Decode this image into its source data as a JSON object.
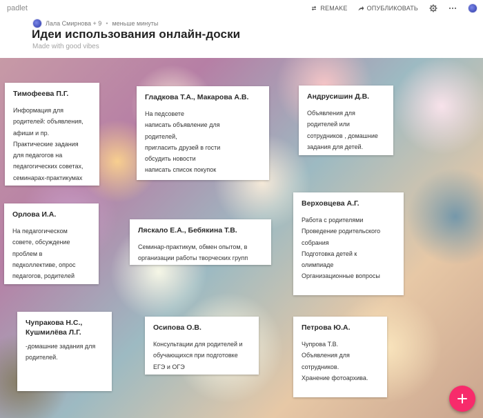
{
  "app": {
    "logo": "padlet"
  },
  "toolbar": {
    "remake_label": "REMAKE",
    "publish_label": "ОПУБЛИКОВАТЬ"
  },
  "header": {
    "authors": "Лала Смирнова + 9",
    "separator": "•",
    "time": "меньше минуты",
    "title": "Идеи использования онлайн-доски",
    "subtitle": "Made with good vibes"
  },
  "cards": [
    {
      "title": "Тимофеева П.Г.",
      "body": "Информация для\nродителей: объявления,\nафиши и пр.\nПрактические задания\nдля педагогов на\nпедагогических советах,\nсеминарах-практикумах"
    },
    {
      "title": "Гладкова Т.А., Макарова А.В.",
      "body": "На педсовете\nнаписать объявление для\nродителей,\nпригласить друзей в гости\nобсудить новости\nнаписать список покупок"
    },
    {
      "title": "Андрусишин Д.В.",
      "body": "Объявления для\nродителей или\nсотрудников , домашние\nзадания для детей."
    },
    {
      "title": "Орлова И.А.",
      "body": "На педагогическом\nсовете, обсуждение\nпроблем в\nпедколлективе, опрос\nпедагогов, родителей"
    },
    {
      "title": "Ляскало Е.А., Бебякина Т.В.",
      "body": "Семинар-практикум, обмен опытом, в\nорганизации работы творческих групп"
    },
    {
      "title": "Верховцева А.Г.",
      "body": "Работа с родителями\nПроведение родительского\nсобрания\nПодготовка детей к\nолимпиаде\nОрганизационные вопросы"
    },
    {
      "title": "Чупракова Н.С.,\nКушмилёва Л.Г.",
      "body": "-домашние задания для\nродителей."
    },
    {
      "title": "Осипова О.В.",
      "body": "Консультации для родителей и\nобучающихся при подготовке\nЕГЭ и ОГЭ"
    },
    {
      "title": "Петрова Ю.А.",
      "body": "Чупрова Т.В.\nОбъявления для\nсотрудников.\nХранение фотоархива."
    }
  ],
  "icons": {
    "remake": "remake-icon",
    "publish": "share-arrow-icon",
    "settings": "gear-icon",
    "more": "more-dots-icon",
    "add": "plus-icon"
  },
  "colors": {
    "fab": "#f72b6b"
  }
}
